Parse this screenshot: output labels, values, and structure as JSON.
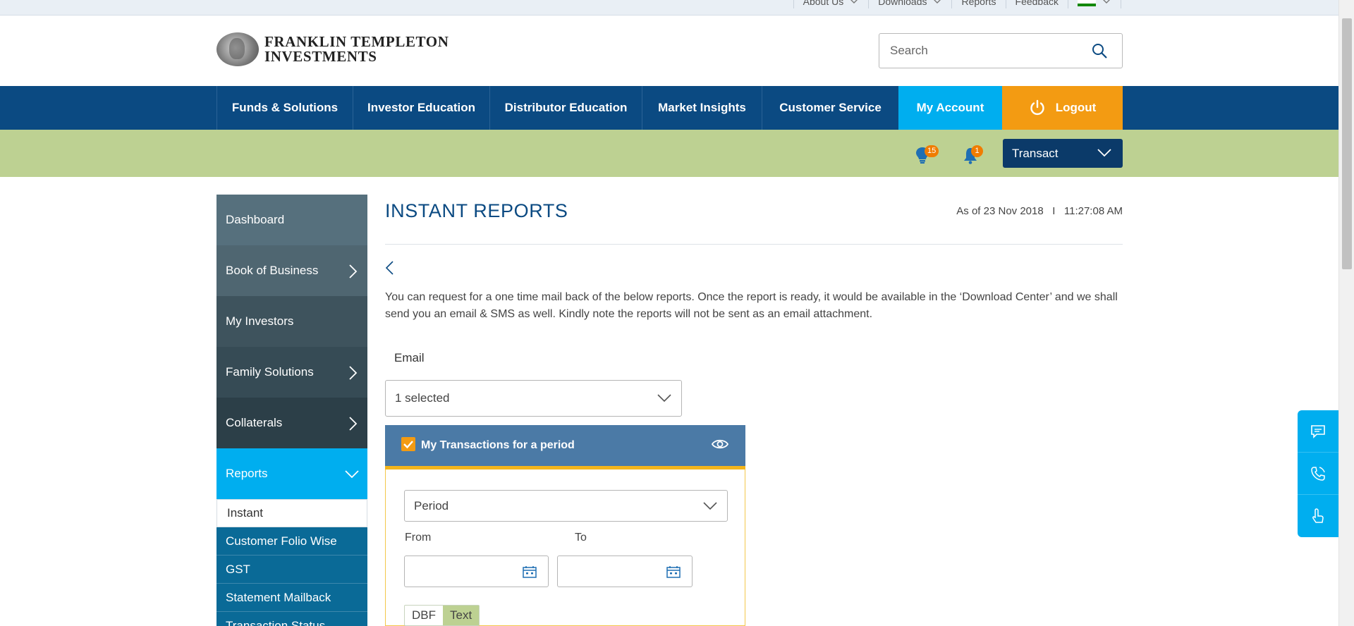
{
  "utility_bar": {
    "links": [
      "About Us",
      "Downloads",
      "Reports",
      "Feedback"
    ]
  },
  "header": {
    "logo_line1": "FRANKLIN TEMPLETON",
    "logo_line2": "INVESTMENTS",
    "search_placeholder": "Search"
  },
  "main_nav": {
    "items": [
      "Funds & Solutions",
      "Investor Education",
      "Distributor Education",
      "Market Insights",
      "Customer Service",
      "My Account",
      "Logout"
    ]
  },
  "sub_bar": {
    "ideas_count": "15",
    "notifications_count": "1",
    "transact_label": "Transact"
  },
  "sidebar": {
    "items": [
      "Dashboard",
      "Book of Business",
      "My Investors",
      "Family Solutions",
      "Collaterals",
      "Reports"
    ],
    "sub_items": [
      "Instant",
      "Customer Folio Wise",
      "GST",
      "Statement Mailback",
      "Transaction Status"
    ]
  },
  "content": {
    "title": "INSTANT REPORTS",
    "as_of": "As of 23 Nov 2018   I   11:27:08 AM",
    "intro": "You can request for a one time mail back of the below reports. Once the report is ready, it would be available in the ‘Download Center’ and we shall send you an email & SMS as well. Kindly note the reports will not be sent as an email attachment.",
    "email_label": "Email",
    "email_select_value": "1 selected"
  },
  "report_card": {
    "title": "My Transactions for a period",
    "period_value": "Period",
    "from_label": "From",
    "to_label": "To",
    "formats": [
      "DBF",
      "Text"
    ],
    "selected_format": "Text"
  },
  "colors": {
    "nav_blue": "#0b4a82",
    "accent_cyan": "#00aeef",
    "logout_orange": "#f39b12",
    "sub_bar_green": "#bdd192",
    "card_header": "#4b7aa6"
  }
}
